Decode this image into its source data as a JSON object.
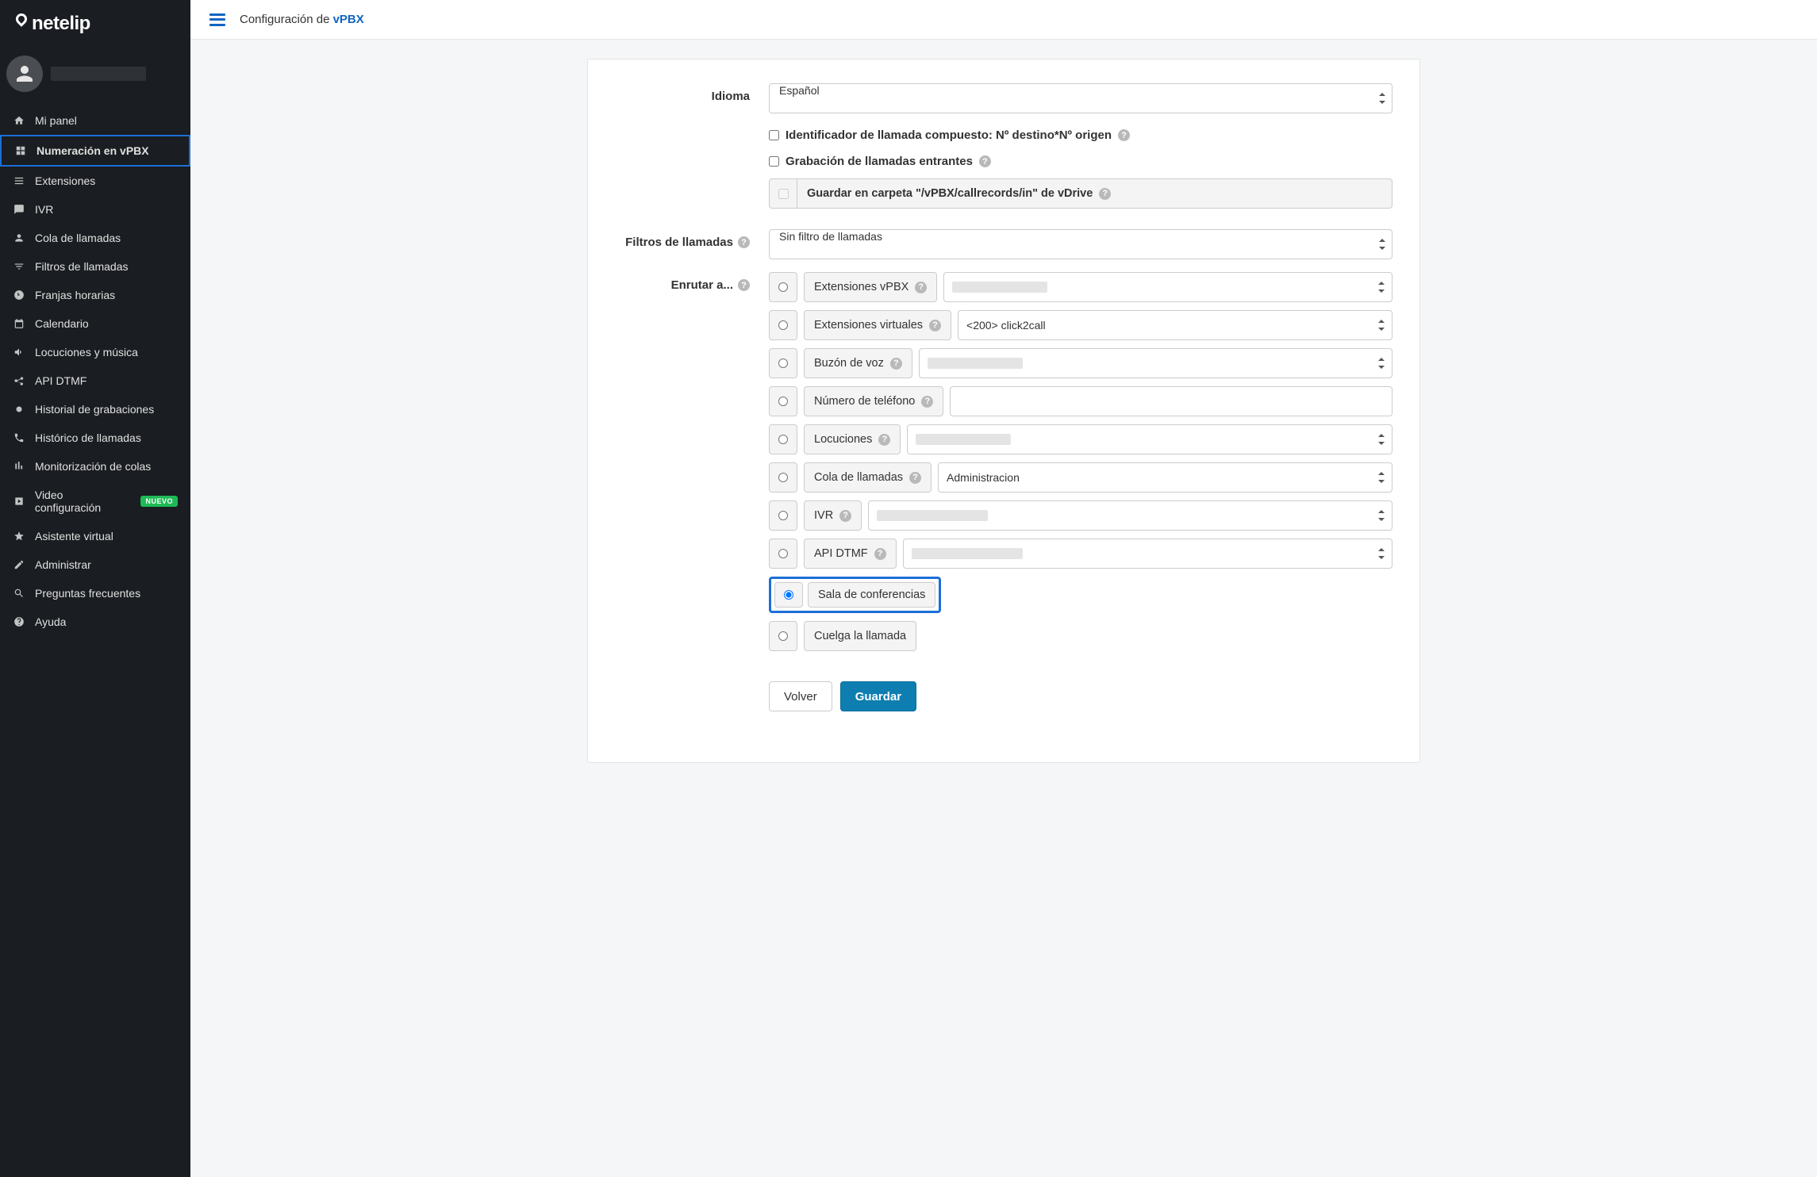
{
  "brand": "netelip",
  "topbar": {
    "title_prefix": "Configuración de ",
    "title_brand": "vPBX"
  },
  "sidebar": {
    "items": [
      {
        "label": "Mi panel"
      },
      {
        "label": "Numeración en vPBX"
      },
      {
        "label": "Extensiones"
      },
      {
        "label": "IVR"
      },
      {
        "label": "Cola de llamadas"
      },
      {
        "label": "Filtros de llamadas"
      },
      {
        "label": "Franjas horarias"
      },
      {
        "label": "Calendario"
      },
      {
        "label": "Locuciones y música"
      },
      {
        "label": "API DTMF"
      },
      {
        "label": "Historial de grabaciones"
      },
      {
        "label": "Histórico de llamadas"
      },
      {
        "label": "Monitorización de colas"
      },
      {
        "label": "Video configuración",
        "badge": "NUEVO"
      },
      {
        "label": "Asistente virtual"
      },
      {
        "label": "Administrar"
      },
      {
        "label": "Preguntas frecuentes"
      },
      {
        "label": "Ayuda"
      }
    ]
  },
  "form": {
    "labels": {
      "idioma": "Idioma",
      "filtros": "Filtros de llamadas",
      "enrutar": "Enrutar a..."
    },
    "idioma_value": "Español",
    "checkbox_id_compuesto": "Identificador de llamada compuesto: Nº destino*Nº origen",
    "checkbox_grabacion": "Grabación de llamadas entrantes",
    "guardar_carpeta": "Guardar en carpeta \"/vPBX/callrecords/in\" de vDrive",
    "filtros_value": "Sin filtro de llamadas",
    "routes": {
      "ext_vpbx": "Extensiones vPBX",
      "ext_virtuales": "Extensiones virtuales",
      "ext_virtuales_value": "<200> click2call",
      "buzon": "Buzón de voz",
      "telefono": "Número de teléfono",
      "locuciones": "Locuciones",
      "cola": "Cola de llamadas",
      "cola_value": "Administracion",
      "ivr": "IVR",
      "api_dtmf": "API DTMF",
      "sala": "Sala de conferencias",
      "cuelga": "Cuelga la llamada"
    },
    "buttons": {
      "volver": "Volver",
      "guardar": "Guardar"
    }
  }
}
